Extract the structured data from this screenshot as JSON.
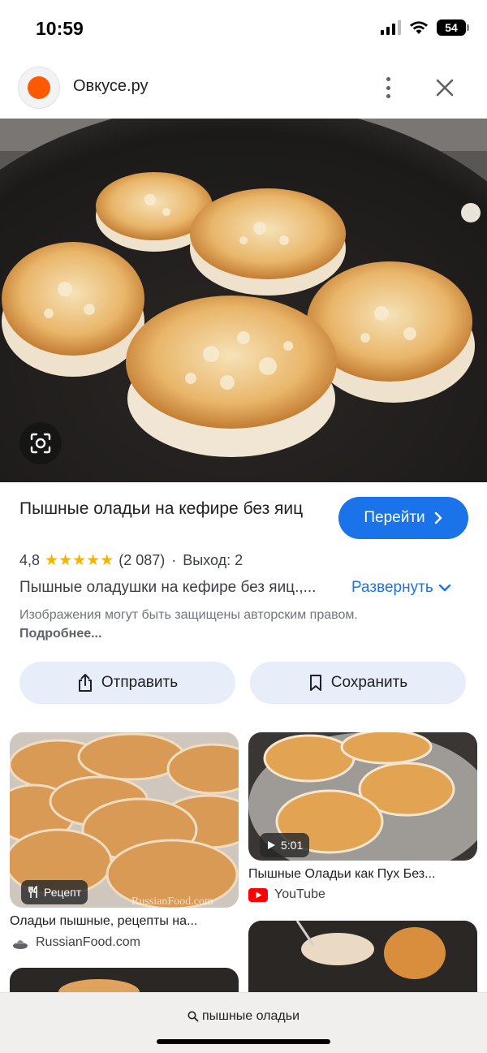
{
  "status": {
    "time": "10:59",
    "battery": "54"
  },
  "header": {
    "site_name": "Овкусе.ру",
    "logo_color": "#ff5a00"
  },
  "hero": {
    "alt": "oladyi-pan-image"
  },
  "result": {
    "title": "Пышные оладьи на кефире без яиц",
    "go_label": "Перейти",
    "rating": "4,8",
    "stars": "★★★★★",
    "reviews": "(2 087)",
    "yield": "Выход: 2",
    "description": "Пышные оладушки на кефире без яиц.,...",
    "expand_label": "Развернуть",
    "copyright_text": "Изображения могут быть защищены авторским правом.",
    "copyright_link": "Подробнее..."
  },
  "actions": {
    "share_label": "Отправить",
    "save_label": "Сохранить"
  },
  "grid": {
    "card1": {
      "badge": "Рецепт",
      "title": "Оладьи пышные, рецепты на...",
      "source": "RussianFood.com",
      "watermark": "RussianFood.com"
    },
    "card2": {
      "badge": "5:01",
      "title": "Пышные Оладьи как Пух Без...",
      "source": "YouTube"
    }
  },
  "bottom": {
    "query": "пышные оладьи"
  },
  "colors": {
    "accent": "#1a73e8",
    "star": "#f4b400",
    "action_bg": "#e8eef9"
  }
}
